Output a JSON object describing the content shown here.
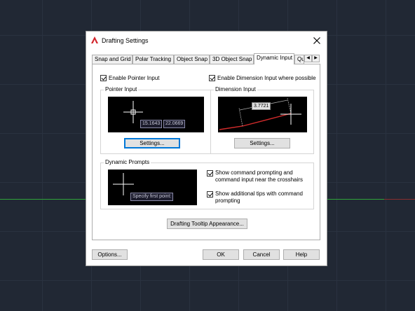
{
  "dialog": {
    "title": "Drafting Settings",
    "tabs": [
      {
        "label": "Snap and Grid"
      },
      {
        "label": "Polar Tracking"
      },
      {
        "label": "Object Snap"
      },
      {
        "label": "3D Object Snap"
      },
      {
        "label": "Dynamic Input",
        "active": true
      },
      {
        "label": "Quic"
      }
    ],
    "pointer": {
      "checkbox_label": "Enable Pointer Input",
      "checked": true,
      "group_label": "Pointer Input",
      "coord_x": "15.1643",
      "coord_y": "22.0669",
      "settings_button": "Settings..."
    },
    "dimension": {
      "checkbox_label": "Enable Dimension Input where possible",
      "checked": true,
      "group_label": "Dimension Input",
      "value": "3.7721",
      "settings_button": "Settings..."
    },
    "prompts": {
      "group_label": "Dynamic Prompts",
      "preview_text": "Specify first point:",
      "option1": "Show command prompting and command input near the crosshairs",
      "option2": "Show additional tips with command prompting"
    },
    "tooltip_button": "Drafting Tooltip Appearance...",
    "footer": {
      "options": "Options...",
      "ok": "OK",
      "cancel": "Cancel",
      "help": "Help"
    }
  },
  "colors": {
    "background": "#212834",
    "accent": "#0078d7",
    "app_icon": "#d2232a"
  }
}
